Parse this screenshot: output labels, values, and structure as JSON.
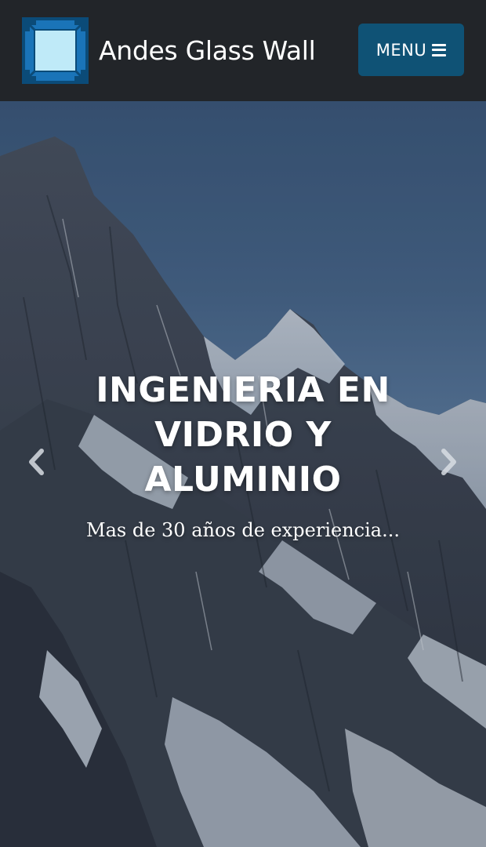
{
  "header": {
    "brand_name": "Andes Glass Wall",
    "menu_label": "MENU",
    "logo_icon": "window-frame-logo",
    "menu_icon": "bars-icon",
    "colors": {
      "navbar_bg": "#222529",
      "menu_button_bg": "#0f5275",
      "logo_blue": "#1a74b8",
      "logo_glass": "#bfeaf8"
    }
  },
  "hero": {
    "title": "INGENIERIA EN VIDRIO Y ALUMINIO",
    "subtitle": "Mas de 30 años de experiencia...",
    "prev_icon": "chevron-left-icon",
    "next_icon": "chevron-right-icon",
    "background": "snowy-mountain-photo"
  }
}
